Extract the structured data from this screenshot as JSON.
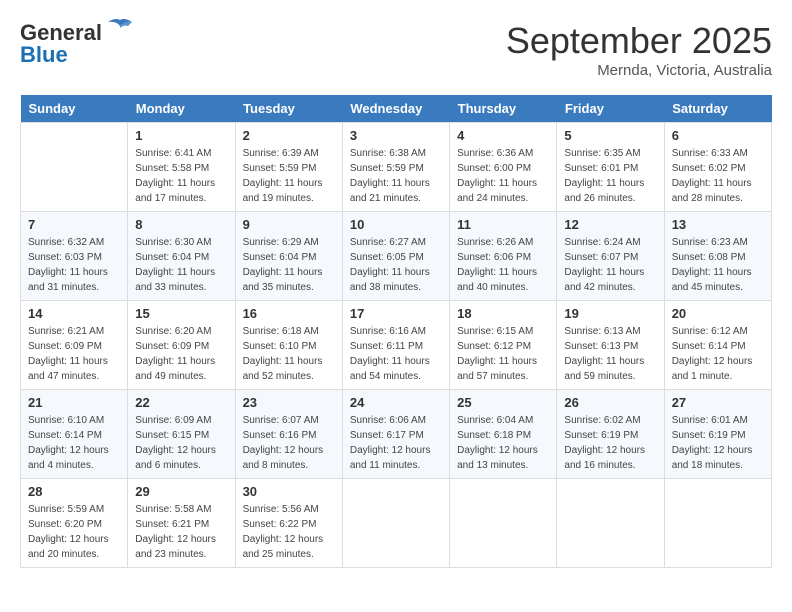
{
  "header": {
    "logo_general": "General",
    "logo_blue": "Blue",
    "month": "September 2025",
    "location": "Mernda, Victoria, Australia"
  },
  "days_of_week": [
    "Sunday",
    "Monday",
    "Tuesday",
    "Wednesday",
    "Thursday",
    "Friday",
    "Saturday"
  ],
  "weeks": [
    [
      {
        "day": "",
        "sunrise": "",
        "sunset": "",
        "daylight": ""
      },
      {
        "day": "1",
        "sunrise": "Sunrise: 6:41 AM",
        "sunset": "Sunset: 5:58 PM",
        "daylight": "Daylight: 11 hours and 17 minutes."
      },
      {
        "day": "2",
        "sunrise": "Sunrise: 6:39 AM",
        "sunset": "Sunset: 5:59 PM",
        "daylight": "Daylight: 11 hours and 19 minutes."
      },
      {
        "day": "3",
        "sunrise": "Sunrise: 6:38 AM",
        "sunset": "Sunset: 5:59 PM",
        "daylight": "Daylight: 11 hours and 21 minutes."
      },
      {
        "day": "4",
        "sunrise": "Sunrise: 6:36 AM",
        "sunset": "Sunset: 6:00 PM",
        "daylight": "Daylight: 11 hours and 24 minutes."
      },
      {
        "day": "5",
        "sunrise": "Sunrise: 6:35 AM",
        "sunset": "Sunset: 6:01 PM",
        "daylight": "Daylight: 11 hours and 26 minutes."
      },
      {
        "day": "6",
        "sunrise": "Sunrise: 6:33 AM",
        "sunset": "Sunset: 6:02 PM",
        "daylight": "Daylight: 11 hours and 28 minutes."
      }
    ],
    [
      {
        "day": "7",
        "sunrise": "Sunrise: 6:32 AM",
        "sunset": "Sunset: 6:03 PM",
        "daylight": "Daylight: 11 hours and 31 minutes."
      },
      {
        "day": "8",
        "sunrise": "Sunrise: 6:30 AM",
        "sunset": "Sunset: 6:04 PM",
        "daylight": "Daylight: 11 hours and 33 minutes."
      },
      {
        "day": "9",
        "sunrise": "Sunrise: 6:29 AM",
        "sunset": "Sunset: 6:04 PM",
        "daylight": "Daylight: 11 hours and 35 minutes."
      },
      {
        "day": "10",
        "sunrise": "Sunrise: 6:27 AM",
        "sunset": "Sunset: 6:05 PM",
        "daylight": "Daylight: 11 hours and 38 minutes."
      },
      {
        "day": "11",
        "sunrise": "Sunrise: 6:26 AM",
        "sunset": "Sunset: 6:06 PM",
        "daylight": "Daylight: 11 hours and 40 minutes."
      },
      {
        "day": "12",
        "sunrise": "Sunrise: 6:24 AM",
        "sunset": "Sunset: 6:07 PM",
        "daylight": "Daylight: 11 hours and 42 minutes."
      },
      {
        "day": "13",
        "sunrise": "Sunrise: 6:23 AM",
        "sunset": "Sunset: 6:08 PM",
        "daylight": "Daylight: 11 hours and 45 minutes."
      }
    ],
    [
      {
        "day": "14",
        "sunrise": "Sunrise: 6:21 AM",
        "sunset": "Sunset: 6:09 PM",
        "daylight": "Daylight: 11 hours and 47 minutes."
      },
      {
        "day": "15",
        "sunrise": "Sunrise: 6:20 AM",
        "sunset": "Sunset: 6:09 PM",
        "daylight": "Daylight: 11 hours and 49 minutes."
      },
      {
        "day": "16",
        "sunrise": "Sunrise: 6:18 AM",
        "sunset": "Sunset: 6:10 PM",
        "daylight": "Daylight: 11 hours and 52 minutes."
      },
      {
        "day": "17",
        "sunrise": "Sunrise: 6:16 AM",
        "sunset": "Sunset: 6:11 PM",
        "daylight": "Daylight: 11 hours and 54 minutes."
      },
      {
        "day": "18",
        "sunrise": "Sunrise: 6:15 AM",
        "sunset": "Sunset: 6:12 PM",
        "daylight": "Daylight: 11 hours and 57 minutes."
      },
      {
        "day": "19",
        "sunrise": "Sunrise: 6:13 AM",
        "sunset": "Sunset: 6:13 PM",
        "daylight": "Daylight: 11 hours and 59 minutes."
      },
      {
        "day": "20",
        "sunrise": "Sunrise: 6:12 AM",
        "sunset": "Sunset: 6:14 PM",
        "daylight": "Daylight: 12 hours and 1 minute."
      }
    ],
    [
      {
        "day": "21",
        "sunrise": "Sunrise: 6:10 AM",
        "sunset": "Sunset: 6:14 PM",
        "daylight": "Daylight: 12 hours and 4 minutes."
      },
      {
        "day": "22",
        "sunrise": "Sunrise: 6:09 AM",
        "sunset": "Sunset: 6:15 PM",
        "daylight": "Daylight: 12 hours and 6 minutes."
      },
      {
        "day": "23",
        "sunrise": "Sunrise: 6:07 AM",
        "sunset": "Sunset: 6:16 PM",
        "daylight": "Daylight: 12 hours and 8 minutes."
      },
      {
        "day": "24",
        "sunrise": "Sunrise: 6:06 AM",
        "sunset": "Sunset: 6:17 PM",
        "daylight": "Daylight: 12 hours and 11 minutes."
      },
      {
        "day": "25",
        "sunrise": "Sunrise: 6:04 AM",
        "sunset": "Sunset: 6:18 PM",
        "daylight": "Daylight: 12 hours and 13 minutes."
      },
      {
        "day": "26",
        "sunrise": "Sunrise: 6:02 AM",
        "sunset": "Sunset: 6:19 PM",
        "daylight": "Daylight: 12 hours and 16 minutes."
      },
      {
        "day": "27",
        "sunrise": "Sunrise: 6:01 AM",
        "sunset": "Sunset: 6:19 PM",
        "daylight": "Daylight: 12 hours and 18 minutes."
      }
    ],
    [
      {
        "day": "28",
        "sunrise": "Sunrise: 5:59 AM",
        "sunset": "Sunset: 6:20 PM",
        "daylight": "Daylight: 12 hours and 20 minutes."
      },
      {
        "day": "29",
        "sunrise": "Sunrise: 5:58 AM",
        "sunset": "Sunset: 6:21 PM",
        "daylight": "Daylight: 12 hours and 23 minutes."
      },
      {
        "day": "30",
        "sunrise": "Sunrise: 5:56 AM",
        "sunset": "Sunset: 6:22 PM",
        "daylight": "Daylight: 12 hours and 25 minutes."
      },
      {
        "day": "",
        "sunrise": "",
        "sunset": "",
        "daylight": ""
      },
      {
        "day": "",
        "sunrise": "",
        "sunset": "",
        "daylight": ""
      },
      {
        "day": "",
        "sunrise": "",
        "sunset": "",
        "daylight": ""
      },
      {
        "day": "",
        "sunrise": "",
        "sunset": "",
        "daylight": ""
      }
    ]
  ]
}
